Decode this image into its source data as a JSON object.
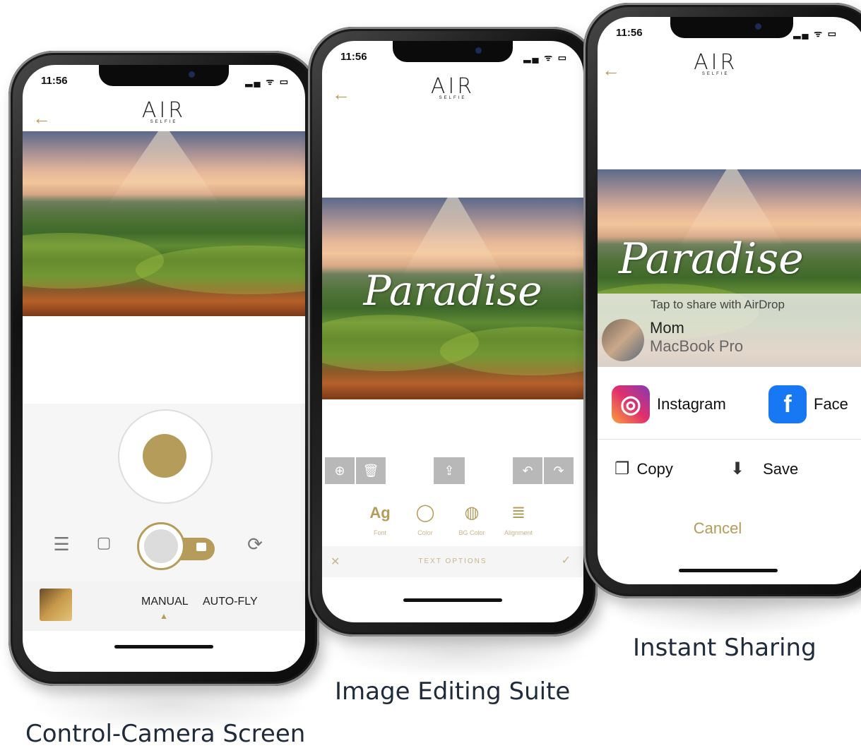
{
  "colors": {
    "accent": "#b59c5a",
    "caption": "#1f2a3a",
    "cancel": "#b59c5a"
  },
  "status": {
    "time": "11:56",
    "icons": "▂▄ ᯤ ▭"
  },
  "app": {
    "logo": "AIR",
    "logo_sub": "SELFIE",
    "back_icon": "←"
  },
  "phone1": {
    "caption": "Control-Camera Screen",
    "modes": [
      "MANUAL",
      "AUTO-FLY"
    ],
    "active_mode_marker": "▲",
    "icons": {
      "sliders": "sliders-icon",
      "sticker": "sticker-icon",
      "video": "video-icon",
      "rotate": "rotate-icon"
    }
  },
  "phone2": {
    "caption": "Image Editing Suite",
    "overlay_text": "Paradise",
    "text_options": [
      {
        "label": "Font",
        "icon": "Ag"
      },
      {
        "label": "Color",
        "icon": "◯"
      },
      {
        "label": "BG Color",
        "icon": "◍"
      },
      {
        "label": "Alignment",
        "icon": "≣"
      }
    ],
    "bottom_bar": {
      "cancel": "✕",
      "title": "TEXT OPTIONS",
      "confirm": "✓"
    }
  },
  "phone3": {
    "caption": "Instant Sharing",
    "overlay_text": "Paradise",
    "airdrop_hint": "Tap to share with AirDrop",
    "airdrop_contact": {
      "name": "Mom",
      "device": "MacBook Pro"
    },
    "apps": [
      {
        "label": "Instagram"
      },
      {
        "label": "Face"
      }
    ],
    "actions": [
      {
        "label": "Copy"
      },
      {
        "label": "Save"
      }
    ],
    "cancel": "Cancel"
  }
}
